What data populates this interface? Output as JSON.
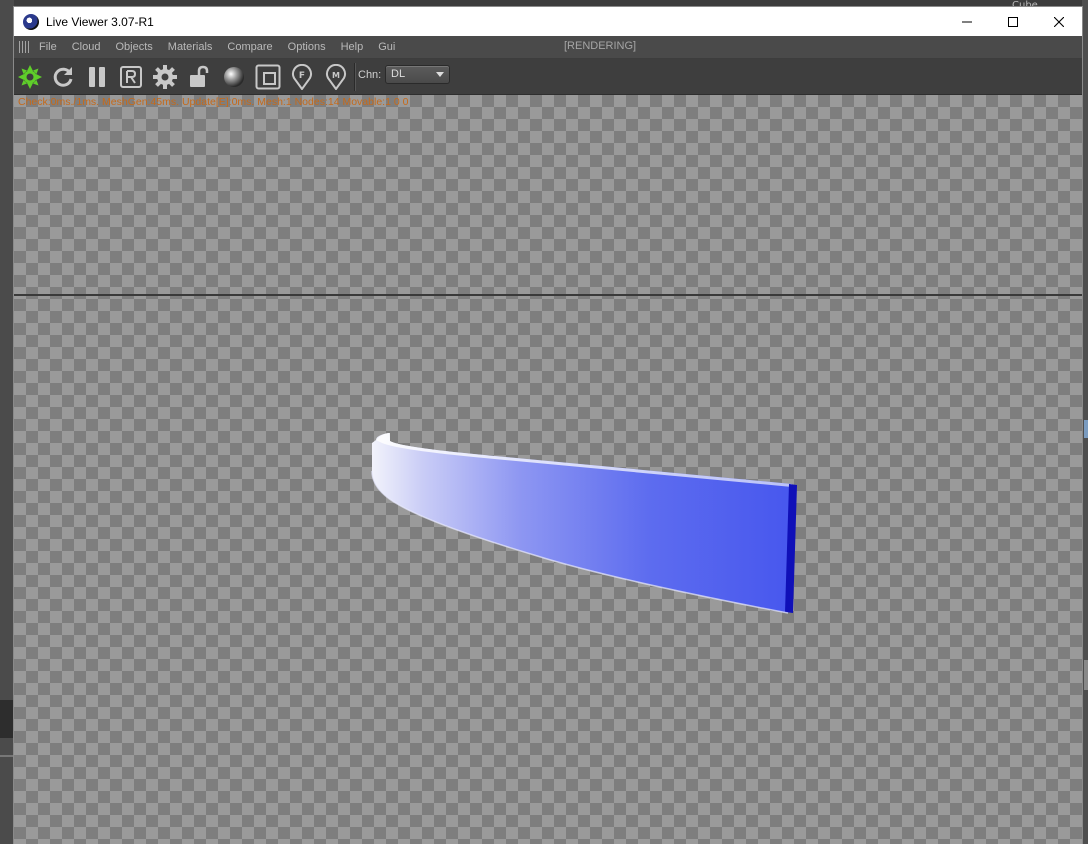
{
  "window": {
    "title": "Live Viewer 3.07-R1"
  },
  "background": {
    "right_panel_label": "Cube"
  },
  "menu": {
    "items": [
      "File",
      "Cloud",
      "Objects",
      "Materials",
      "Compare",
      "Options",
      "Help",
      "Gui"
    ],
    "status": "[RENDERING]"
  },
  "toolbar": {
    "icons": [
      "send-scene-icon",
      "restart-icon",
      "pause-icon",
      "region-render-icon",
      "settings-icon",
      "lock-icon",
      "material-ball-icon",
      "clay-mode-icon",
      "focus-picker-icon",
      "material-picker-icon"
    ],
    "channel_label": "Chn:",
    "channel_value": "DL"
  },
  "viewport": {
    "stats": "Check:0ms./1ms. MeshGen:45ms. Update[E]:0ms. Mesh:1 Nodes:14 Movable:1  0 0",
    "colors": {
      "object_blue": "#4a5cf0",
      "object_edge": "#1010b8",
      "stats_text": "#c66a1a"
    }
  }
}
